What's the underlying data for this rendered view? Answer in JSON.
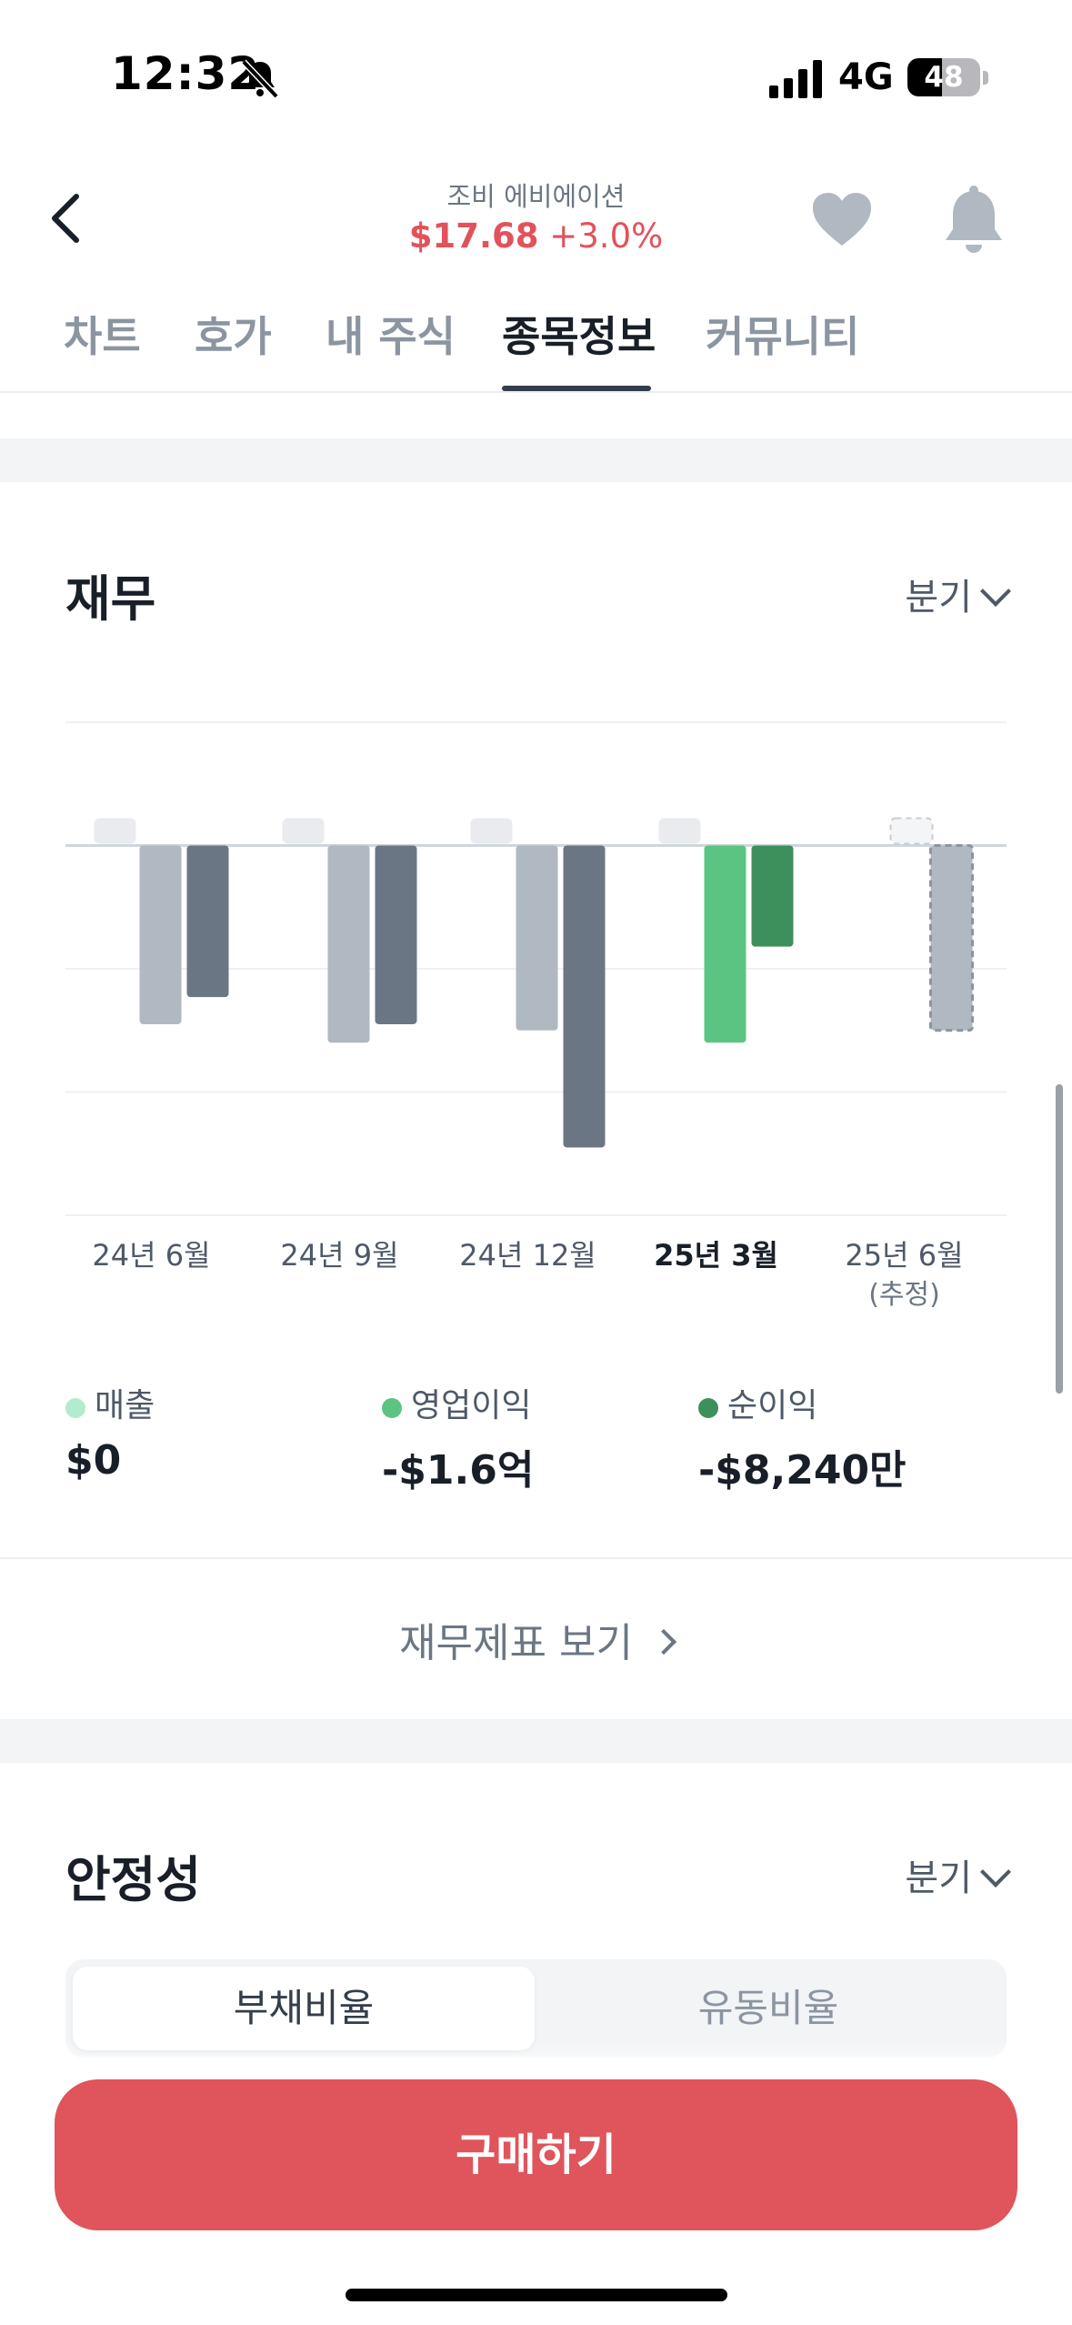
{
  "status_bar": {
    "time": "12:32",
    "network": "4G",
    "battery": "48",
    "battery_level": 0.48
  },
  "header": {
    "stock_name": "조비 에비에이션",
    "price": "$17.68",
    "change": "+3.0%"
  },
  "tabs": [
    "차트",
    "호가",
    "내 주식",
    "종목정보",
    "커뮤니티"
  ],
  "active_tab": "종목정보",
  "finance": {
    "title": "재무",
    "period": "분기",
    "highlighted_period": "25년 3월",
    "legend": [
      {
        "label": "매출",
        "value": "$0",
        "color": "#b3ebd0"
      },
      {
        "label": "영업이익",
        "value": "-$1.6억",
        "color": "#5cc483"
      },
      {
        "label": "순이익",
        "value": "-$8,240만",
        "color": "#3d8f5b"
      }
    ],
    "statements_link": "재무제표 보기"
  },
  "chart_data": {
    "type": "bar",
    "categories": [
      "24년 6월",
      "24년 9월",
      "24년 12월",
      "25년 3월",
      "25년 6월"
    ],
    "category_notes": [
      "",
      "",
      "",
      "",
      "(추정)"
    ],
    "ylabel": "",
    "unit": "억 달러",
    "ylim": [
      -3.0,
      1.0
    ],
    "series": [
      {
        "name": "매출",
        "values": [
          0,
          0,
          0,
          0,
          0
        ]
      },
      {
        "name": "영업이익",
        "values": [
          -1.45,
          -1.6,
          -1.5,
          -1.6,
          -1.5
        ]
      },
      {
        "name": "순이익",
        "values": [
          -1.23,
          -1.45,
          -2.45,
          -0.82,
          null
        ]
      }
    ],
    "estimated_last": true,
    "grid": true
  },
  "stability": {
    "title": "안정성",
    "period": "분기",
    "segments": [
      "부채비율",
      "유동비율"
    ],
    "active_segment": "부채비율"
  },
  "buy_button": "구매하기"
}
